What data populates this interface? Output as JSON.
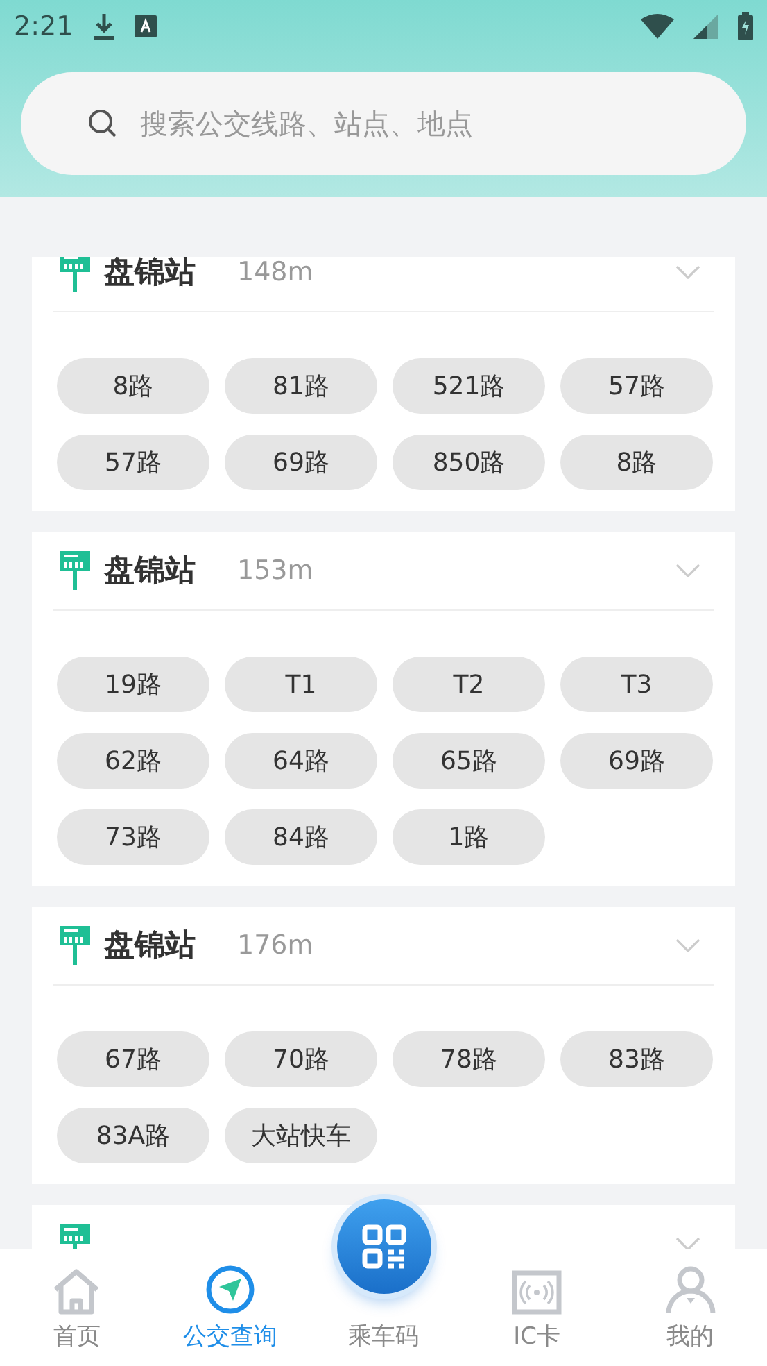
{
  "status_bar": {
    "time": "2:21"
  },
  "search": {
    "placeholder": "搜索公交线路、站点、地点"
  },
  "stations": [
    {
      "name": "盘锦站",
      "distance": "148m",
      "routes": [
        "8路",
        "81路",
        "521路",
        "57路",
        "57路",
        "69路",
        "850路",
        "8路"
      ]
    },
    {
      "name": "盘锦站",
      "distance": "153m",
      "routes": [
        "19路",
        "T1",
        "T2",
        "T3",
        "62路",
        "64路",
        "65路",
        "69路",
        "73路",
        "84路",
        "1路"
      ]
    },
    {
      "name": "盘锦站",
      "distance": "176m",
      "routes": [
        "67路",
        "70路",
        "78路",
        "83路",
        "83A路",
        "大站快车"
      ]
    },
    {
      "kind": "cut"
    }
  ],
  "nav": [
    {
      "label": "首页",
      "kind": "home",
      "selected": false
    },
    {
      "label": "公交查询",
      "kind": "bus",
      "selected": true
    },
    {
      "label": "乘车码",
      "kind": "qr",
      "selected": false
    },
    {
      "label": "IC卡",
      "kind": "card",
      "selected": false
    },
    {
      "label": "我的",
      "kind": "me",
      "selected": false
    }
  ]
}
